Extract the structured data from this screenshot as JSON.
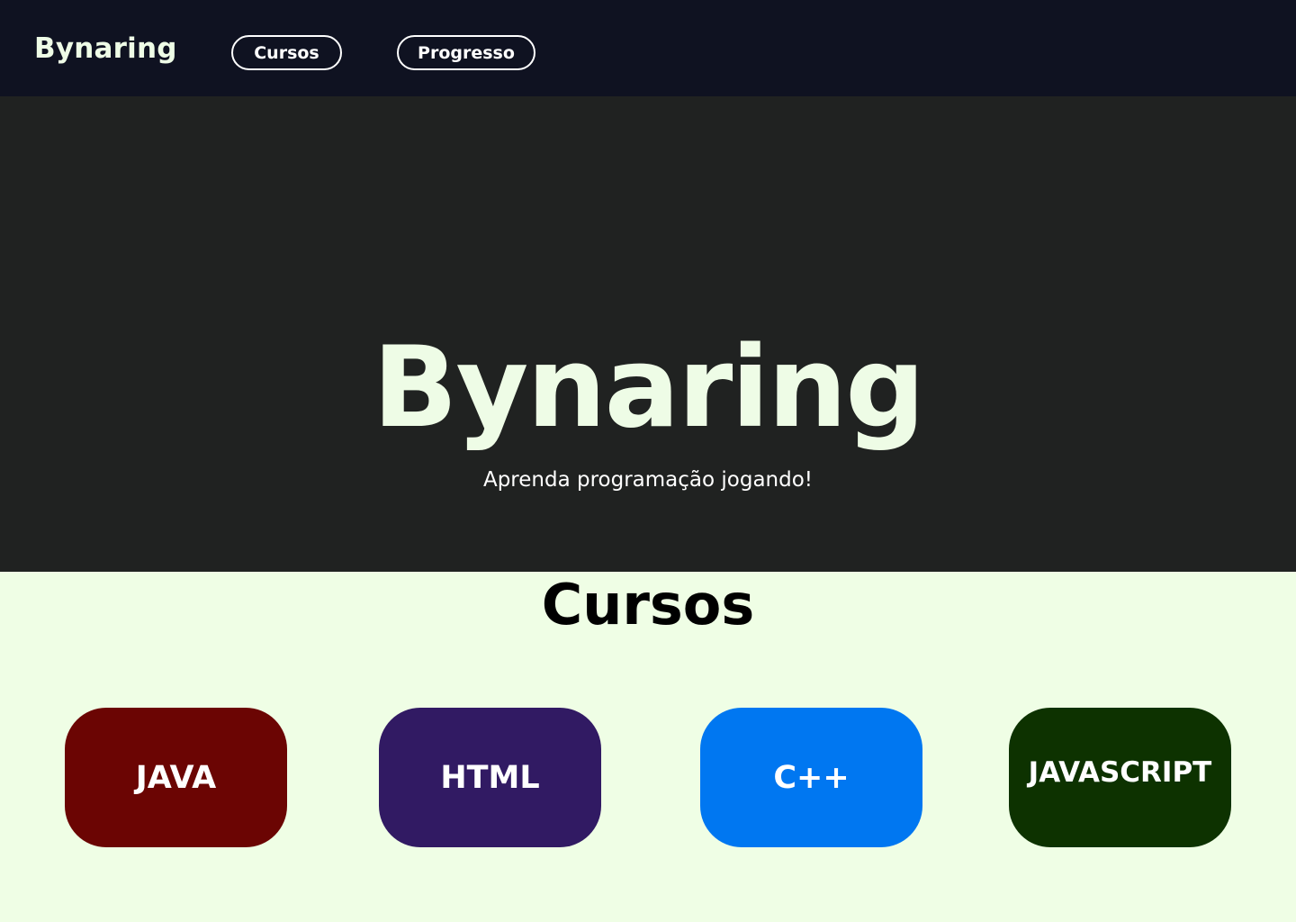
{
  "nav": {
    "logo": "Bynaring",
    "links": [
      {
        "label": "Cursos"
      },
      {
        "label": "Progresso"
      }
    ],
    "background": "#0f1221"
  },
  "hero": {
    "title": "Bynaring",
    "subtitle": "Aprenda programação jogando!",
    "background": "#202221",
    "title_color": "#eefce6"
  },
  "courses": {
    "title": "Cursos",
    "background": "#effee5",
    "cards": [
      {
        "label": "JAVA",
        "color": "#6b0503"
      },
      {
        "label": "HTML",
        "color": "#311a63"
      },
      {
        "label": "C++",
        "color": "#0077f1"
      },
      {
        "label": "JAVASCRIPT",
        "color": "#0d3200"
      }
    ]
  }
}
